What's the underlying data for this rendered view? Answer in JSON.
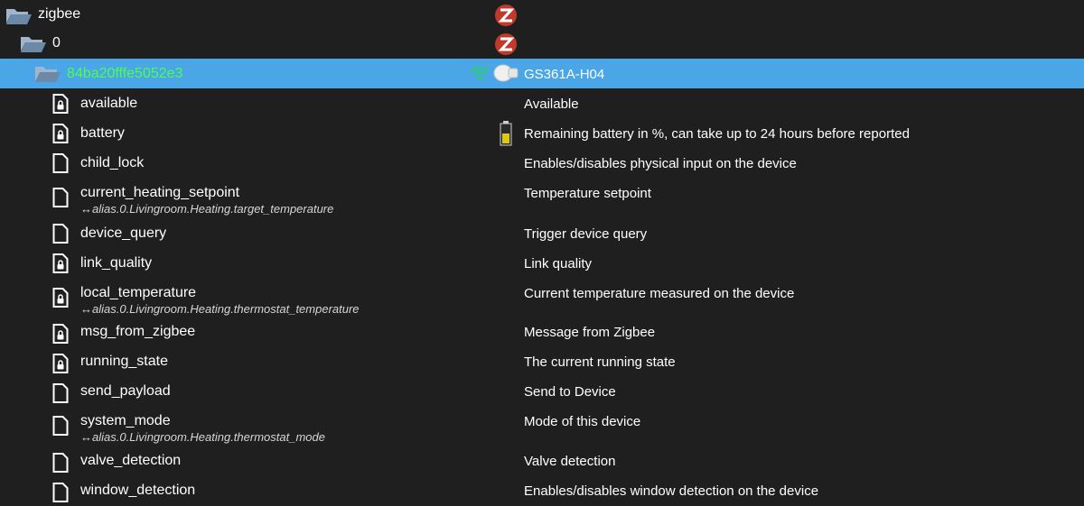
{
  "tree": {
    "root": {
      "name": "zigbee",
      "icon": "folder-open-icon"
    },
    "instance": {
      "name": "0",
      "icon": "folder-open-icon"
    },
    "device": {
      "id": "84ba20fffe5052e3",
      "name": "GS361A-H04",
      "id_color": "#4dff4d",
      "signal_color": "#2ecc71",
      "selected_color": "#4aa6e6"
    },
    "states": [
      {
        "name": "available",
        "desc": "Available",
        "icon": "read-only-state-icon"
      },
      {
        "name": "battery",
        "desc": "Remaining battery in %, can take up to 24 hours before reported",
        "icon": "read-only-state-icon",
        "battery_icon": true
      },
      {
        "name": "child_lock",
        "desc": "Enables/disables physical input on the device",
        "icon": "state-icon"
      },
      {
        "name": "current_heating_setpoint",
        "alias": "↔alias.0.Livingroom.Heating.target_temperature",
        "desc": "Temperature setpoint",
        "icon": "state-icon"
      },
      {
        "name": "device_query",
        "desc": "Trigger device query",
        "icon": "state-icon"
      },
      {
        "name": "link_quality",
        "desc": "Link quality",
        "icon": "read-only-state-icon"
      },
      {
        "name": "local_temperature",
        "alias": "↔alias.0.Livingroom.Heating.thermostat_temperature",
        "desc": "Current temperature measured on the device",
        "icon": "read-only-state-icon"
      },
      {
        "name": "msg_from_zigbee",
        "desc": "Message from Zigbee",
        "icon": "read-only-state-icon"
      },
      {
        "name": "running_state",
        "desc": "The current running state",
        "icon": "read-only-state-icon"
      },
      {
        "name": "send_payload",
        "desc": "Send to Device",
        "icon": "state-icon"
      },
      {
        "name": "system_mode",
        "alias": "↔alias.0.Livingroom.Heating.thermostat_mode",
        "desc": "Mode of this device",
        "icon": "state-icon"
      },
      {
        "name": "valve_detection",
        "desc": "Valve detection",
        "icon": "state-icon"
      },
      {
        "name": "window_detection",
        "desc": "Enables/disables window detection on the device",
        "icon": "state-icon"
      }
    ]
  }
}
